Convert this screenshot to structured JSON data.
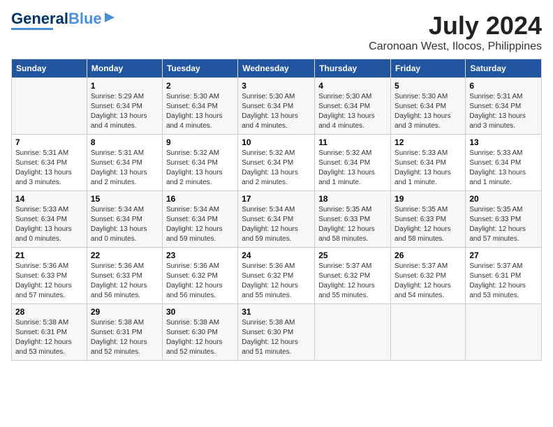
{
  "logo": {
    "text1": "General",
    "text2": "Blue"
  },
  "title": "July 2024",
  "location": "Caronoan West, Ilocos, Philippines",
  "days_of_week": [
    "Sunday",
    "Monday",
    "Tuesday",
    "Wednesday",
    "Thursday",
    "Friday",
    "Saturday"
  ],
  "weeks": [
    [
      {
        "num": "",
        "info": ""
      },
      {
        "num": "1",
        "info": "Sunrise: 5:29 AM\nSunset: 6:34 PM\nDaylight: 13 hours\nand 4 minutes."
      },
      {
        "num": "2",
        "info": "Sunrise: 5:30 AM\nSunset: 6:34 PM\nDaylight: 13 hours\nand 4 minutes."
      },
      {
        "num": "3",
        "info": "Sunrise: 5:30 AM\nSunset: 6:34 PM\nDaylight: 13 hours\nand 4 minutes."
      },
      {
        "num": "4",
        "info": "Sunrise: 5:30 AM\nSunset: 6:34 PM\nDaylight: 13 hours\nand 4 minutes."
      },
      {
        "num": "5",
        "info": "Sunrise: 5:30 AM\nSunset: 6:34 PM\nDaylight: 13 hours\nand 3 minutes."
      },
      {
        "num": "6",
        "info": "Sunrise: 5:31 AM\nSunset: 6:34 PM\nDaylight: 13 hours\nand 3 minutes."
      }
    ],
    [
      {
        "num": "7",
        "info": "Sunrise: 5:31 AM\nSunset: 6:34 PM\nDaylight: 13 hours\nand 3 minutes."
      },
      {
        "num": "8",
        "info": "Sunrise: 5:31 AM\nSunset: 6:34 PM\nDaylight: 13 hours\nand 2 minutes."
      },
      {
        "num": "9",
        "info": "Sunrise: 5:32 AM\nSunset: 6:34 PM\nDaylight: 13 hours\nand 2 minutes."
      },
      {
        "num": "10",
        "info": "Sunrise: 5:32 AM\nSunset: 6:34 PM\nDaylight: 13 hours\nand 2 minutes."
      },
      {
        "num": "11",
        "info": "Sunrise: 5:32 AM\nSunset: 6:34 PM\nDaylight: 13 hours\nand 1 minute."
      },
      {
        "num": "12",
        "info": "Sunrise: 5:33 AM\nSunset: 6:34 PM\nDaylight: 13 hours\nand 1 minute."
      },
      {
        "num": "13",
        "info": "Sunrise: 5:33 AM\nSunset: 6:34 PM\nDaylight: 13 hours\nand 1 minute."
      }
    ],
    [
      {
        "num": "14",
        "info": "Sunrise: 5:33 AM\nSunset: 6:34 PM\nDaylight: 13 hours\nand 0 minutes."
      },
      {
        "num": "15",
        "info": "Sunrise: 5:34 AM\nSunset: 6:34 PM\nDaylight: 13 hours\nand 0 minutes."
      },
      {
        "num": "16",
        "info": "Sunrise: 5:34 AM\nSunset: 6:34 PM\nDaylight: 12 hours\nand 59 minutes."
      },
      {
        "num": "17",
        "info": "Sunrise: 5:34 AM\nSunset: 6:34 PM\nDaylight: 12 hours\nand 59 minutes."
      },
      {
        "num": "18",
        "info": "Sunrise: 5:35 AM\nSunset: 6:33 PM\nDaylight: 12 hours\nand 58 minutes."
      },
      {
        "num": "19",
        "info": "Sunrise: 5:35 AM\nSunset: 6:33 PM\nDaylight: 12 hours\nand 58 minutes."
      },
      {
        "num": "20",
        "info": "Sunrise: 5:35 AM\nSunset: 6:33 PM\nDaylight: 12 hours\nand 57 minutes."
      }
    ],
    [
      {
        "num": "21",
        "info": "Sunrise: 5:36 AM\nSunset: 6:33 PM\nDaylight: 12 hours\nand 57 minutes."
      },
      {
        "num": "22",
        "info": "Sunrise: 5:36 AM\nSunset: 6:33 PM\nDaylight: 12 hours\nand 56 minutes."
      },
      {
        "num": "23",
        "info": "Sunrise: 5:36 AM\nSunset: 6:32 PM\nDaylight: 12 hours\nand 56 minutes."
      },
      {
        "num": "24",
        "info": "Sunrise: 5:36 AM\nSunset: 6:32 PM\nDaylight: 12 hours\nand 55 minutes."
      },
      {
        "num": "25",
        "info": "Sunrise: 5:37 AM\nSunset: 6:32 PM\nDaylight: 12 hours\nand 55 minutes."
      },
      {
        "num": "26",
        "info": "Sunrise: 5:37 AM\nSunset: 6:32 PM\nDaylight: 12 hours\nand 54 minutes."
      },
      {
        "num": "27",
        "info": "Sunrise: 5:37 AM\nSunset: 6:31 PM\nDaylight: 12 hours\nand 53 minutes."
      }
    ],
    [
      {
        "num": "28",
        "info": "Sunrise: 5:38 AM\nSunset: 6:31 PM\nDaylight: 12 hours\nand 53 minutes."
      },
      {
        "num": "29",
        "info": "Sunrise: 5:38 AM\nSunset: 6:31 PM\nDaylight: 12 hours\nand 52 minutes."
      },
      {
        "num": "30",
        "info": "Sunrise: 5:38 AM\nSunset: 6:30 PM\nDaylight: 12 hours\nand 52 minutes."
      },
      {
        "num": "31",
        "info": "Sunrise: 5:38 AM\nSunset: 6:30 PM\nDaylight: 12 hours\nand 51 minutes."
      },
      {
        "num": "",
        "info": ""
      },
      {
        "num": "",
        "info": ""
      },
      {
        "num": "",
        "info": ""
      }
    ]
  ]
}
